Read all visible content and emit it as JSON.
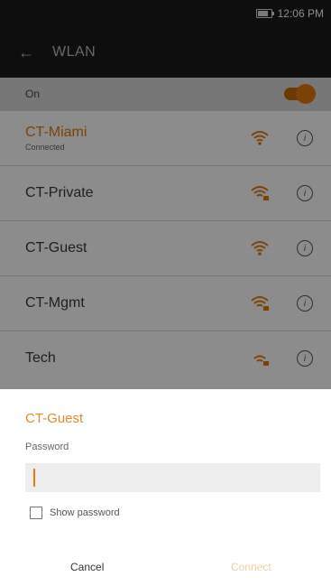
{
  "status_bar": {
    "time": "12:06 PM"
  },
  "app_bar": {
    "back_icon": "arrow-left-icon",
    "title": "WLAN"
  },
  "wlan_toggle": {
    "label": "On",
    "state": "on"
  },
  "networks": [
    {
      "name": "CT-Miami",
      "status": "Connected",
      "active": true
    },
    {
      "name": "CT-Private",
      "status": "",
      "active": false
    },
    {
      "name": "CT-Guest",
      "status": "",
      "active": false
    },
    {
      "name": "CT-Mgmt",
      "status": "",
      "active": false
    },
    {
      "name": "Tech",
      "status": "",
      "active": false
    }
  ],
  "dialog": {
    "title": "CT-Guest",
    "password_label": "Password",
    "password_value": "",
    "show_password_label": "Show password",
    "cancel_label": "Cancel",
    "connect_label": "Connect"
  },
  "colors": {
    "accent": "#e07b12",
    "bar": "#1b1b1b"
  }
}
